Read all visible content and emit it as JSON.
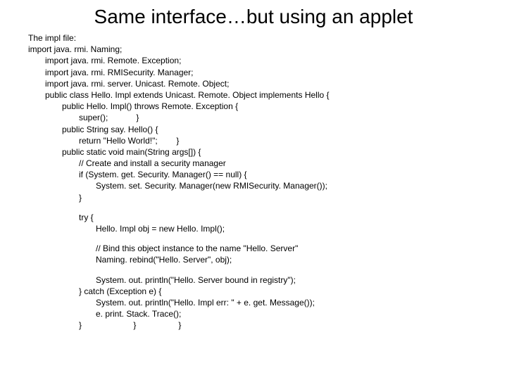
{
  "title": "Same interface…but using an applet",
  "lines": [
    {
      "indent": 0,
      "text": "The impl file:"
    },
    {
      "indent": 0,
      "text": "import java. rmi. Naming;"
    },
    {
      "indent": 1,
      "text": "import java. rmi. Remote. Exception;"
    },
    {
      "indent": 1,
      "text": "import java. rmi. RMISecurity. Manager;"
    },
    {
      "indent": 1,
      "text": "import java. rmi. server. Unicast. Remote. Object;"
    },
    {
      "indent": 1,
      "text": "public class Hello. Impl extends Unicast. Remote. Object implements Hello {"
    },
    {
      "indent": 2,
      "text": "public Hello. Impl() throws Remote. Exception {"
    },
    {
      "indent": 3,
      "text": "super();            }"
    },
    {
      "indent": 2,
      "text": "public String say. Hello() {"
    },
    {
      "indent": 3,
      "text": "return \"Hello World!\";        }"
    },
    {
      "indent": 2,
      "text": "public static void main(String args[]) {"
    },
    {
      "indent": 3,
      "text": "// Create and install a security manager"
    },
    {
      "indent": 3,
      "text": "if (System. get. Security. Manager() == null) {"
    },
    {
      "indent": 4,
      "text": "System. set. Security. Manager(new RMISecurity. Manager());"
    },
    {
      "indent": 3,
      "text": "}"
    },
    {
      "indent": 0,
      "text": "",
      "gap": true
    },
    {
      "indent": 3,
      "text": "try {"
    },
    {
      "indent": 4,
      "text": "Hello. Impl obj = new Hello. Impl();"
    },
    {
      "indent": 0,
      "text": "",
      "gap": true
    },
    {
      "indent": 4,
      "text": "// Bind this object instance to the name \"Hello. Server\""
    },
    {
      "indent": 4,
      "text": "Naming. rebind(\"Hello. Server\", obj);"
    },
    {
      "indent": 0,
      "text": "",
      "gap": true
    },
    {
      "indent": 4,
      "text": "System. out. println(\"Hello. Server bound in registry\");"
    },
    {
      "indent": 3,
      "text": "} catch (Exception e) {"
    },
    {
      "indent": 4,
      "text": "System. out. println(\"Hello. Impl err: \" + e. get. Message());"
    },
    {
      "indent": 4,
      "text": "e. print. Stack. Trace();"
    },
    {
      "indent": 3,
      "text": "}                      }                  }"
    }
  ]
}
